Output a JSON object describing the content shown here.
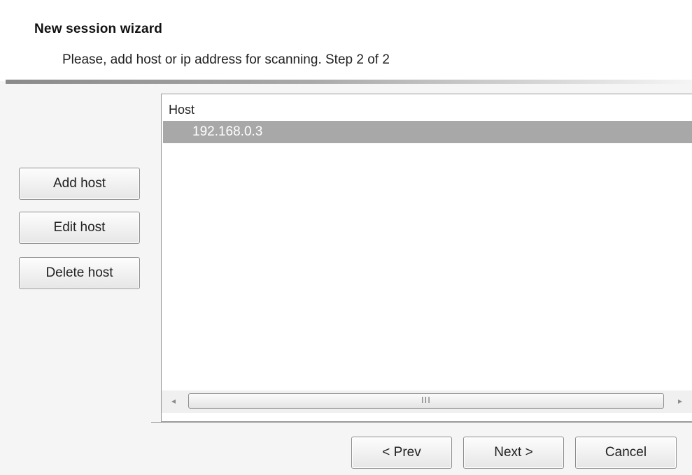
{
  "wizard": {
    "title": "New session wizard",
    "subtitle": "Please, add host or ip address for scanning.  Step 2 of 2"
  },
  "actions": {
    "add_host": "Add host",
    "edit_host": "Edit host",
    "delete_host": "Delete host"
  },
  "host_list": {
    "column_header": "Host",
    "rows": [
      {
        "host": "192.168.0.3",
        "selected": true
      }
    ],
    "scrollbar": {
      "left_arrow": "◂",
      "right_arrow": "▸",
      "grip": "III"
    }
  },
  "footer": {
    "prev_label": "< Prev",
    "next_label": "Next >",
    "cancel_label": "Cancel"
  },
  "colors": {
    "selection": "#a8a8a8",
    "header_background": "#ffffff",
    "dialog_background": "#f5f5f5"
  }
}
